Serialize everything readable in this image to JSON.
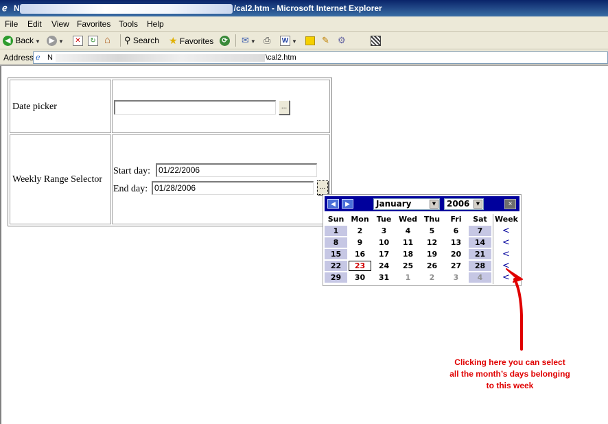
{
  "window": {
    "title_start": "N",
    "title_end": "/cal2.htm - Microsoft Internet Explorer",
    "icon": "ie-icon"
  },
  "menu": {
    "items": [
      "File",
      "Edit",
      "View",
      "Favorites",
      "Tools",
      "Help"
    ]
  },
  "toolbar": {
    "back_label": "Back",
    "search_label": "Search",
    "favorites_label": "Favorites"
  },
  "address": {
    "label": "Address",
    "url_start": "N",
    "url_end": "\\cal2.htm"
  },
  "form": {
    "date_picker_label": "Date picker",
    "date_picker_value": "",
    "date_picker_button": "...",
    "weekly_label": "Weekly Range Selector",
    "start_label": "Start day:",
    "start_value": "01/22/2006",
    "end_label": "End day:",
    "end_value": "01/28/2006",
    "range_button": "..."
  },
  "calendar": {
    "month": "January",
    "year": "2006",
    "close": "×",
    "prev": "◀",
    "next": "▶",
    "headers": [
      "Sun",
      "Mon",
      "Tue",
      "Wed",
      "Thu",
      "Fri",
      "Sat",
      "Week"
    ],
    "week_symbol": "<",
    "weeks": [
      [
        "1",
        "2",
        "3",
        "4",
        "5",
        "6",
        "7"
      ],
      [
        "8",
        "9",
        "10",
        "11",
        "12",
        "13",
        "14"
      ],
      [
        "15",
        "16",
        "17",
        "18",
        "19",
        "20",
        "21"
      ],
      [
        "22",
        "23",
        "24",
        "25",
        "26",
        "27",
        "28"
      ],
      [
        "29",
        "30",
        "31",
        "1",
        "2",
        "3",
        "4"
      ]
    ],
    "selected_day": "23"
  },
  "annotation": {
    "line1": "Clicking here you can select",
    "line2": "all the month’s days belonging",
    "line3": "to this week",
    "color": "#e00000"
  },
  "colors": {
    "calendar_header": "#00009c",
    "weekend_bg": "#c6c7e4",
    "annotation": "#e00000"
  }
}
